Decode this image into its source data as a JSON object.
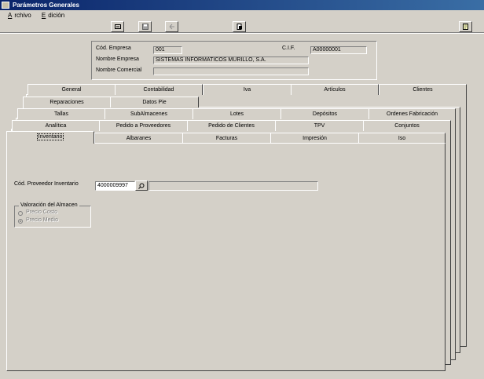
{
  "window": {
    "title": "Parámetros Generales"
  },
  "menu": {
    "items": [
      {
        "label": "Archivo"
      },
      {
        "label": "Edición"
      }
    ]
  },
  "toolbar": {
    "icons": [
      "exit-icon",
      "save-icon",
      "undo-icon",
      "print-icon",
      "help-icon"
    ]
  },
  "header": {
    "empresa_label": "Cód. Empresa",
    "empresa_value": "001",
    "cif_label": "C.I.F.",
    "cif_value": "A00000001",
    "nombre_label": "Nombre Empresa",
    "nombre_value": "SISTEMAS INFORMATICOS MURILLO, S.A.",
    "comercial_label": "Nombre Comercial",
    "comercial_value": ""
  },
  "tabs": {
    "row1": [
      "General",
      "Contabilidad",
      "Iva",
      "Artículos",
      "Clientes"
    ],
    "row2": [
      "Reparaciones",
      "Datos Pie"
    ],
    "row3": [
      "Tallas",
      "SubAlmacenes",
      "Lotes",
      "Depósitos",
      "Ordenes Fabricación"
    ],
    "row4": [
      "Analítica",
      "Pedido a Proveedores",
      "Pedido de Clientes",
      "TPV",
      "Conjuntos"
    ],
    "row5": [
      "Inventario",
      "Albaranes",
      "Facturas",
      "Impresión",
      "Iso"
    ],
    "active": "Inventario"
  },
  "inventario": {
    "proveedor_label": "Cód. Proveedor Inventario",
    "proveedor_value": "4000009997",
    "proveedor_nombre": "",
    "valoracion_title": "Valoración del Almacen",
    "option_costo": "Precio Costo",
    "option_medio": "Precio Medio",
    "selected": "Precio Medio"
  }
}
